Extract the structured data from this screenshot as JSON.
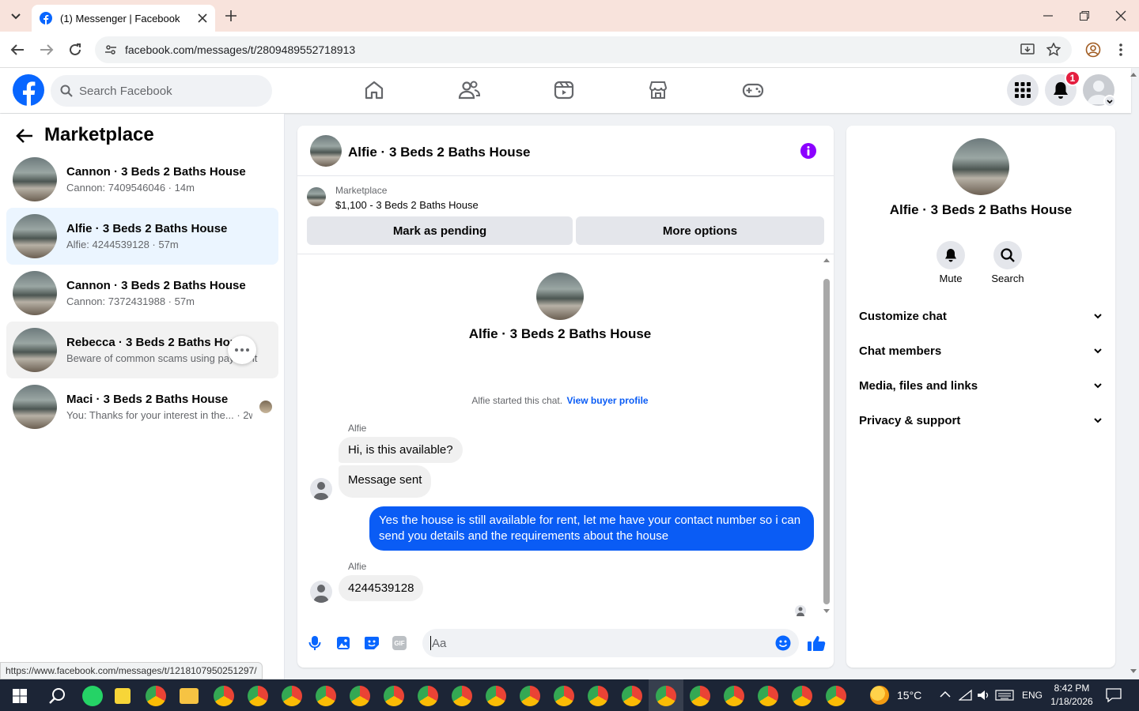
{
  "browser": {
    "tab_title": "(1) Messenger | Facebook",
    "url": "facebook.com/messages/t/2809489552718913",
    "status_url": "https://www.facebook.com/messages/t/1218107950251297/"
  },
  "fb": {
    "search_placeholder": "Search Facebook",
    "notification_count": "1"
  },
  "left": {
    "title": "Marketplace",
    "conversations": [
      {
        "name": "Cannon · 3 Beds 2 Baths House",
        "preview": "Cannon: 7409546046 · 14m"
      },
      {
        "name": "Alfie · 3 Beds 2 Baths House",
        "preview": "Alfie: 4244539128 · 57m"
      },
      {
        "name": "Cannon · 3 Beds 2 Baths House",
        "preview": "Cannon: 7372431988 · 57m"
      },
      {
        "name": "Rebecca · 3 Beds 2 Baths House",
        "preview": "Beware of common scams using payment"
      },
      {
        "name": "Maci · 3 Beds 2 Baths House",
        "preview": "You: Thanks for your interest in the... · 2w"
      }
    ]
  },
  "chat": {
    "header_title": "Alfie · 3 Beds 2 Baths House",
    "listing_label": "Marketplace",
    "listing_price": "$1,100 - 3 Beds 2 Baths House",
    "mark_pending": "Mark as pending",
    "more_options": "More options",
    "profile_name": "Alfie · 3 Beds 2 Baths House",
    "started_text": "Alfie started this chat.",
    "view_buyer": "View buyer profile",
    "sender1": "Alfie",
    "msg1": "Hi, is this available?",
    "msg2": "Message sent",
    "msg3": "Yes the house is still available for rent, let me have your contact number so i can send you details and the requirements about the house",
    "sender2": "Alfie",
    "msg4": "4244539128",
    "input_placeholder": "Aa"
  },
  "right": {
    "name": "Alfie · 3 Beds 2 Baths House",
    "mute": "Mute",
    "search": "Search",
    "sections": [
      "Customize chat",
      "Chat members",
      "Media, files and links",
      "Privacy & support"
    ]
  },
  "taskbar": {
    "temp": "15°C",
    "lang": "ENG",
    "time": "8:42 PM",
    "date": "1/18/2026"
  },
  "colors": {
    "fb_blue": "#0866ff",
    "chat_blue": "#0a5cf5",
    "notif_red": "#e41e3f"
  }
}
